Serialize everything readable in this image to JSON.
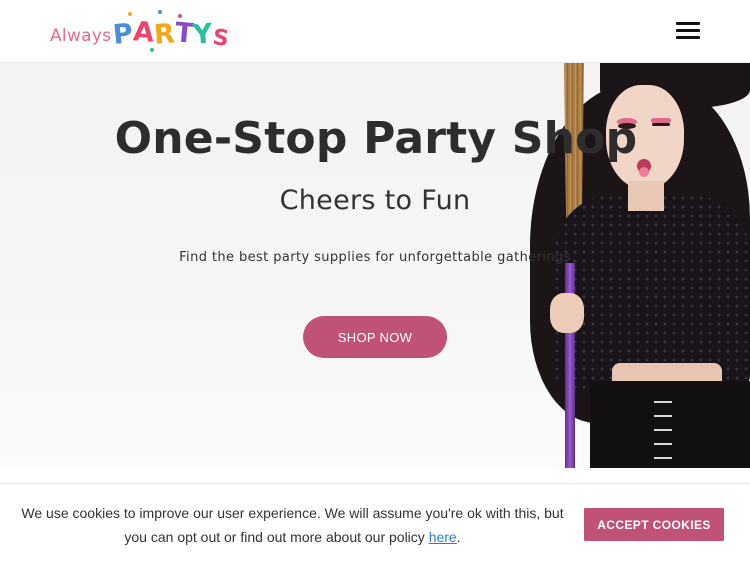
{
  "header": {
    "logo": {
      "always": "Always",
      "party": [
        "P",
        "A",
        "R",
        "T",
        "Y",
        "S"
      ]
    },
    "menu_icon": "hamburger-menu-icon"
  },
  "hero": {
    "title": "One-Stop Party Shop",
    "subtitle": "Cheers to Fun",
    "description": "Find the best party supplies for unforgettable gatherings",
    "cta_label": "SHOP NOW"
  },
  "cookie_bar": {
    "message": "We use cookies to improve our user experience. We will assume you're ok with this, but you can opt out or find out more about our policy ",
    "link_text": "here",
    "trailing": ".",
    "accept_label": "ACCEPT COOKIES"
  },
  "colors": {
    "accent": "#c05277",
    "link": "#2b7fd1",
    "text": "#2f2c2d"
  }
}
